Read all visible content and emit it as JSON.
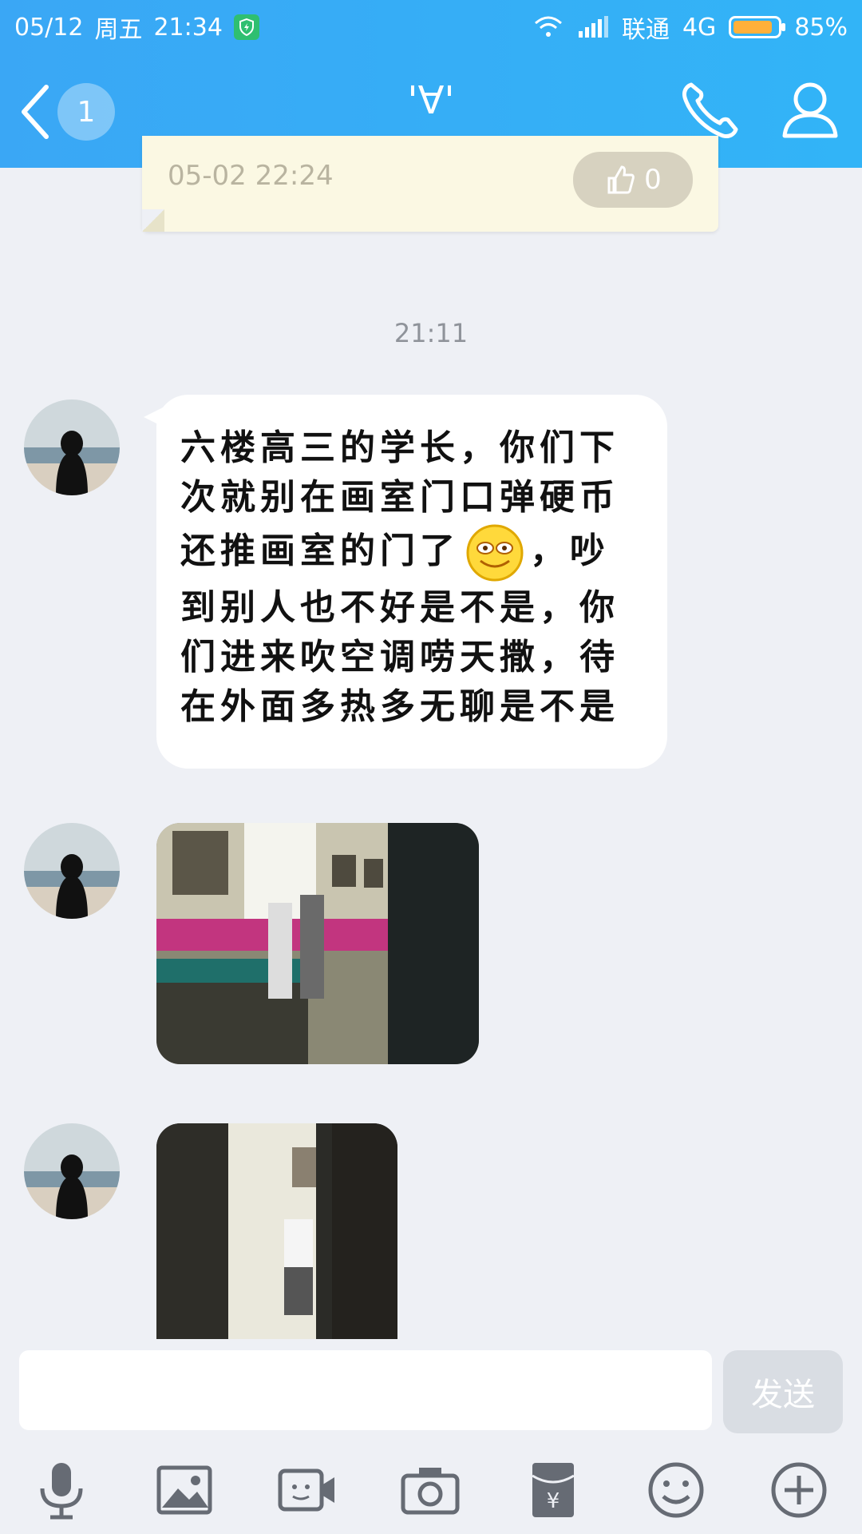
{
  "status": {
    "date": "05/12",
    "weekday": "周五",
    "time": "21:34",
    "carrier": "联通",
    "network": "4G",
    "battery": "85%"
  },
  "nav": {
    "unread_count": "1",
    "title": "'∀'"
  },
  "old_card": {
    "time": "05-02 22:24",
    "likes": "0"
  },
  "chat": {
    "timestamp": "21:11",
    "message_before_emoji": "六楼高三的学长，你们下次就别在画室门口弹硬币还推画室的门了",
    "message_after_emoji": "，吵到别人也不好是不是，你们进来吹空调唠天撒，待在外面多热多无聊是不是"
  },
  "input": {
    "placeholder": "",
    "send_label": "发送"
  },
  "icons": [
    "microphone-icon",
    "image-icon",
    "video-icon",
    "camera-icon",
    "red-packet-icon",
    "emoji-icon",
    "plus-icon"
  ],
  "colors": {
    "header": "#3aa7f5",
    "background": "#eef0f5",
    "bubble": "#ffffff"
  }
}
